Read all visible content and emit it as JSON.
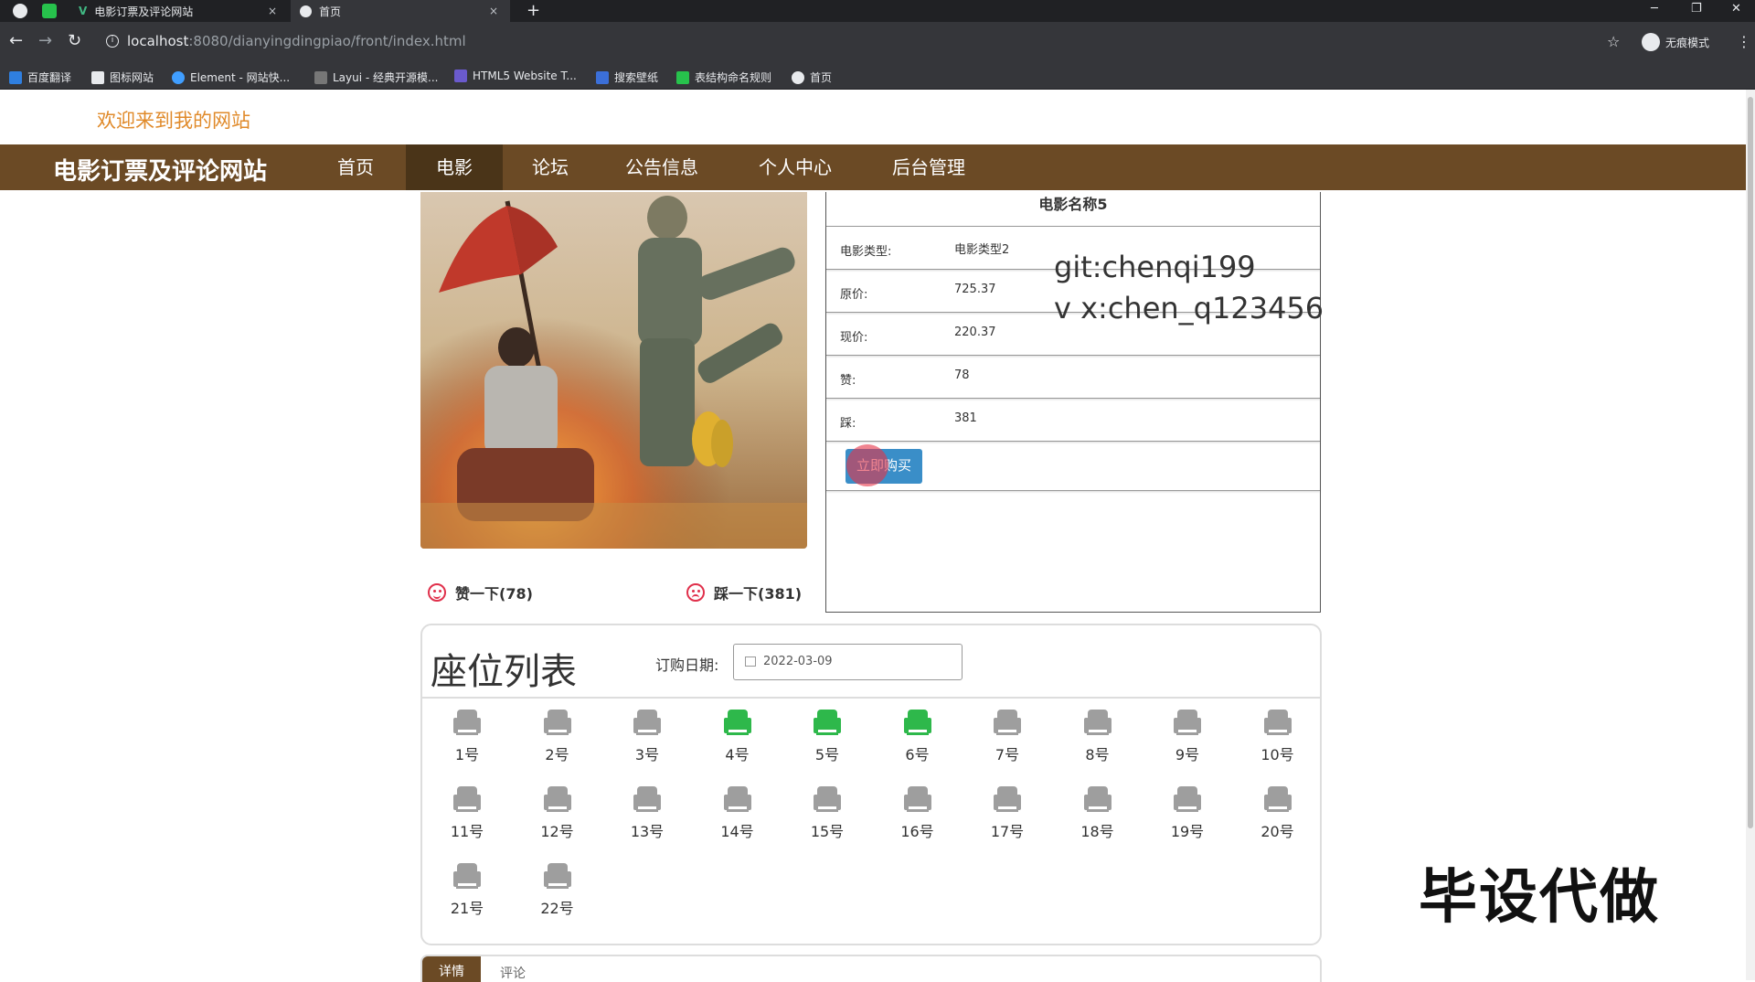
{
  "browser": {
    "tabs": [
      {
        "title": "电影订票及评论网站",
        "close": "×"
      },
      {
        "title": "首页",
        "close": "×"
      }
    ],
    "new_tab": "+",
    "url_host": "localhost",
    "url_path": ":8080/dianyingdingpiao/front/index.html",
    "profile_label": "无痕模式",
    "bookmarks": [
      "百度翻译",
      "图标网站",
      "Element - 网站快...",
      "Layui - 经典开源模...",
      "HTML5 Website T...",
      "搜索壁纸",
      "表结构命名规则",
      "首页"
    ]
  },
  "site": {
    "welcome": "欢迎来到我的网站",
    "brand": "电影订票及评论网站",
    "nav": [
      "首页",
      "电影",
      "论坛",
      "公告信息",
      "个人中心",
      "后台管理"
    ],
    "active_nav": "电影"
  },
  "movie": {
    "name": "电影名称5",
    "rows": [
      {
        "label": "电影类型:",
        "value": "电影类型2"
      },
      {
        "label": "原价:",
        "value": "725.37"
      },
      {
        "label": "现价:",
        "value": "220.37"
      },
      {
        "label": "赞:",
        "value": "78"
      },
      {
        "label": "踩:",
        "value": "381"
      }
    ],
    "buy_label": "立即购买",
    "like_label": "赞一下(78)",
    "dislike_label": "踩一下(381)"
  },
  "watermark": {
    "line1": "git:chenqi199",
    "line2": "v x:chen_q123456"
  },
  "seats": {
    "title": "座位列表",
    "date_label": "订购日期:",
    "date_value": "2022-03-09",
    "list": [
      {
        "label": "1号",
        "status": "available"
      },
      {
        "label": "2号",
        "status": "available"
      },
      {
        "label": "3号",
        "status": "available"
      },
      {
        "label": "4号",
        "status": "booked"
      },
      {
        "label": "5号",
        "status": "booked"
      },
      {
        "label": "6号",
        "status": "booked"
      },
      {
        "label": "7号",
        "status": "available"
      },
      {
        "label": "8号",
        "status": "available"
      },
      {
        "label": "9号",
        "status": "available"
      },
      {
        "label": "10号",
        "status": "available"
      },
      {
        "label": "11号",
        "status": "available"
      },
      {
        "label": "12号",
        "status": "available"
      },
      {
        "label": "13号",
        "status": "available"
      },
      {
        "label": "14号",
        "status": "available"
      },
      {
        "label": "15号",
        "status": "available"
      },
      {
        "label": "16号",
        "status": "available"
      },
      {
        "label": "17号",
        "status": "available"
      },
      {
        "label": "18号",
        "status": "available"
      },
      {
        "label": "19号",
        "status": "available"
      },
      {
        "label": "20号",
        "status": "available"
      },
      {
        "label": "21号",
        "status": "available"
      },
      {
        "label": "22号",
        "status": "available"
      }
    ],
    "colors": {
      "available": "#9e9e9e",
      "booked": "#2eb84b"
    }
  },
  "bottom_tabs": {
    "detail": "详情",
    "comment": "评论"
  },
  "corner_text": "毕设代做",
  "theme": {
    "nav_bg": "#6b4a25",
    "nav_active": "#4a3418",
    "welcome": "#e08a2a",
    "buy_btn": "#3a8ec8"
  }
}
